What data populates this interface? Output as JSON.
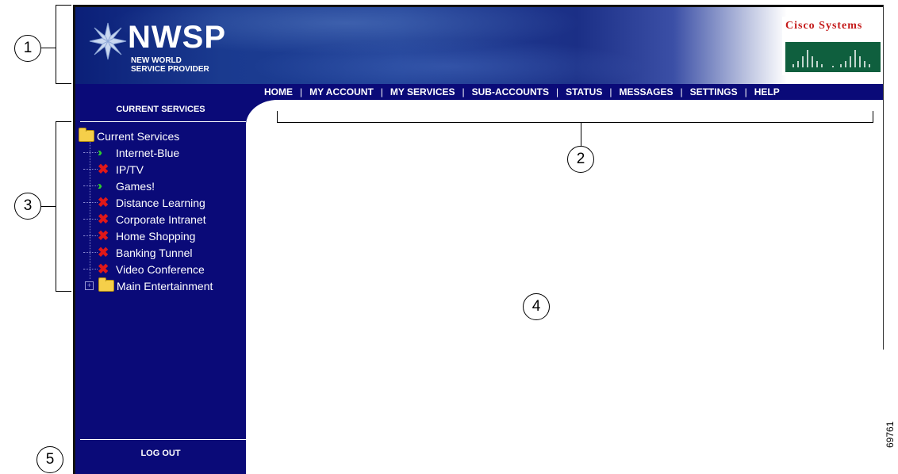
{
  "banner": {
    "logo_title": "NWSP",
    "logo_subtitle_line1": "NEW WORLD",
    "logo_subtitle_line2": "SERVICE PROVIDER",
    "partner_name": "Cisco Systems",
    "partner_color": "#c41a1a"
  },
  "nav": {
    "items": [
      "HOME",
      "MY ACCOUNT",
      "MY SERVICES",
      "SUB-ACCOUNTS",
      "STATUS",
      "MESSAGES",
      "SETTINGS",
      "HELP"
    ],
    "separator": "|"
  },
  "sidebar": {
    "title": "CURRENT SERVICES",
    "logout": "LOG OUT",
    "tree": {
      "root": "Current Services",
      "services": [
        {
          "label": "Internet-Blue",
          "status_icon": "active-arrow-icon"
        },
        {
          "label": "IP/TV",
          "status_icon": "inactive-x-icon"
        },
        {
          "label": "Games!",
          "status_icon": "active-arrow-icon"
        },
        {
          "label": "Distance Learning",
          "status_icon": "inactive-x-icon"
        },
        {
          "label": "Corporate Intranet",
          "status_icon": "inactive-x-icon"
        },
        {
          "label": "Home Shopping",
          "status_icon": "inactive-x-icon"
        },
        {
          "label": "Banking Tunnel",
          "status_icon": "inactive-x-icon"
        },
        {
          "label": "Video Conference",
          "status_icon": "inactive-x-icon"
        }
      ],
      "collapsed_folder": "Main Entertainment"
    }
  },
  "callouts": [
    "1",
    "2",
    "3",
    "4",
    "5"
  ],
  "figure_number": "69761",
  "colors": {
    "nav_bg": "#0a0a78",
    "active": "#2ecc2e",
    "inactive": "#e01818"
  }
}
